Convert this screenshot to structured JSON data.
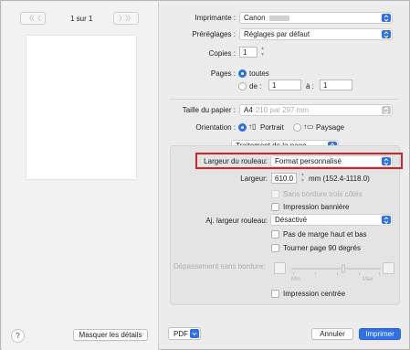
{
  "preview": {
    "page_indicator": "1 sur 1",
    "prev_label": "〈〈 〈",
    "next_label": "〉 〉〉",
    "show_details_button": "Masquer les détails",
    "help_label": "?"
  },
  "form": {
    "printer_label": "Imprimante :",
    "printer_value": "Canon",
    "presets_label": "Préréglages :",
    "presets_value": "Réglages par défaut",
    "copies_label": "Copies :",
    "copies_value": "1",
    "pages_label": "Pages :",
    "pages_all": "toutes",
    "pages_from_label": "de :",
    "pages_from_value": "1",
    "pages_to_label": "à :",
    "pages_to_value": "1",
    "paper_size_label": "Taille du papier :",
    "paper_size_value": "A4",
    "paper_size_dims": "210 par 297 mm",
    "orientation_label": "Orientation :",
    "orientation_portrait": "Portrait",
    "orientation_landscape": "Paysage",
    "section_select": "Traitement de la page"
  },
  "roll": {
    "roll_width_label": "Largeur du rouleau:",
    "roll_width_value": "Format personnalisé",
    "width_label": "Largeur:",
    "width_value": "610.0",
    "width_unit": "mm (152.4-1118.0)",
    "borderless_3_sides": "Sans bordure trois côtés",
    "banner_print": "Impression bannière",
    "adjust_width_label": "Aj. largeur rouleau:",
    "adjust_width_value": "Désactivé",
    "no_top_bottom_margin": "Pas de marge haut et bas",
    "rotate_90": "Tourner page 90 degrés",
    "borderless_overflow_label": "Dépassement sans bordure:",
    "slider_min": "Min",
    "slider_max": "Max",
    "centered_print": "Impression centrée"
  },
  "footer": {
    "pdf_label": "PDF",
    "cancel_label": "Annuler",
    "print_label": "Imprimer"
  },
  "colors": {
    "accent": "#2f6fea",
    "highlight": "#d9202a"
  }
}
